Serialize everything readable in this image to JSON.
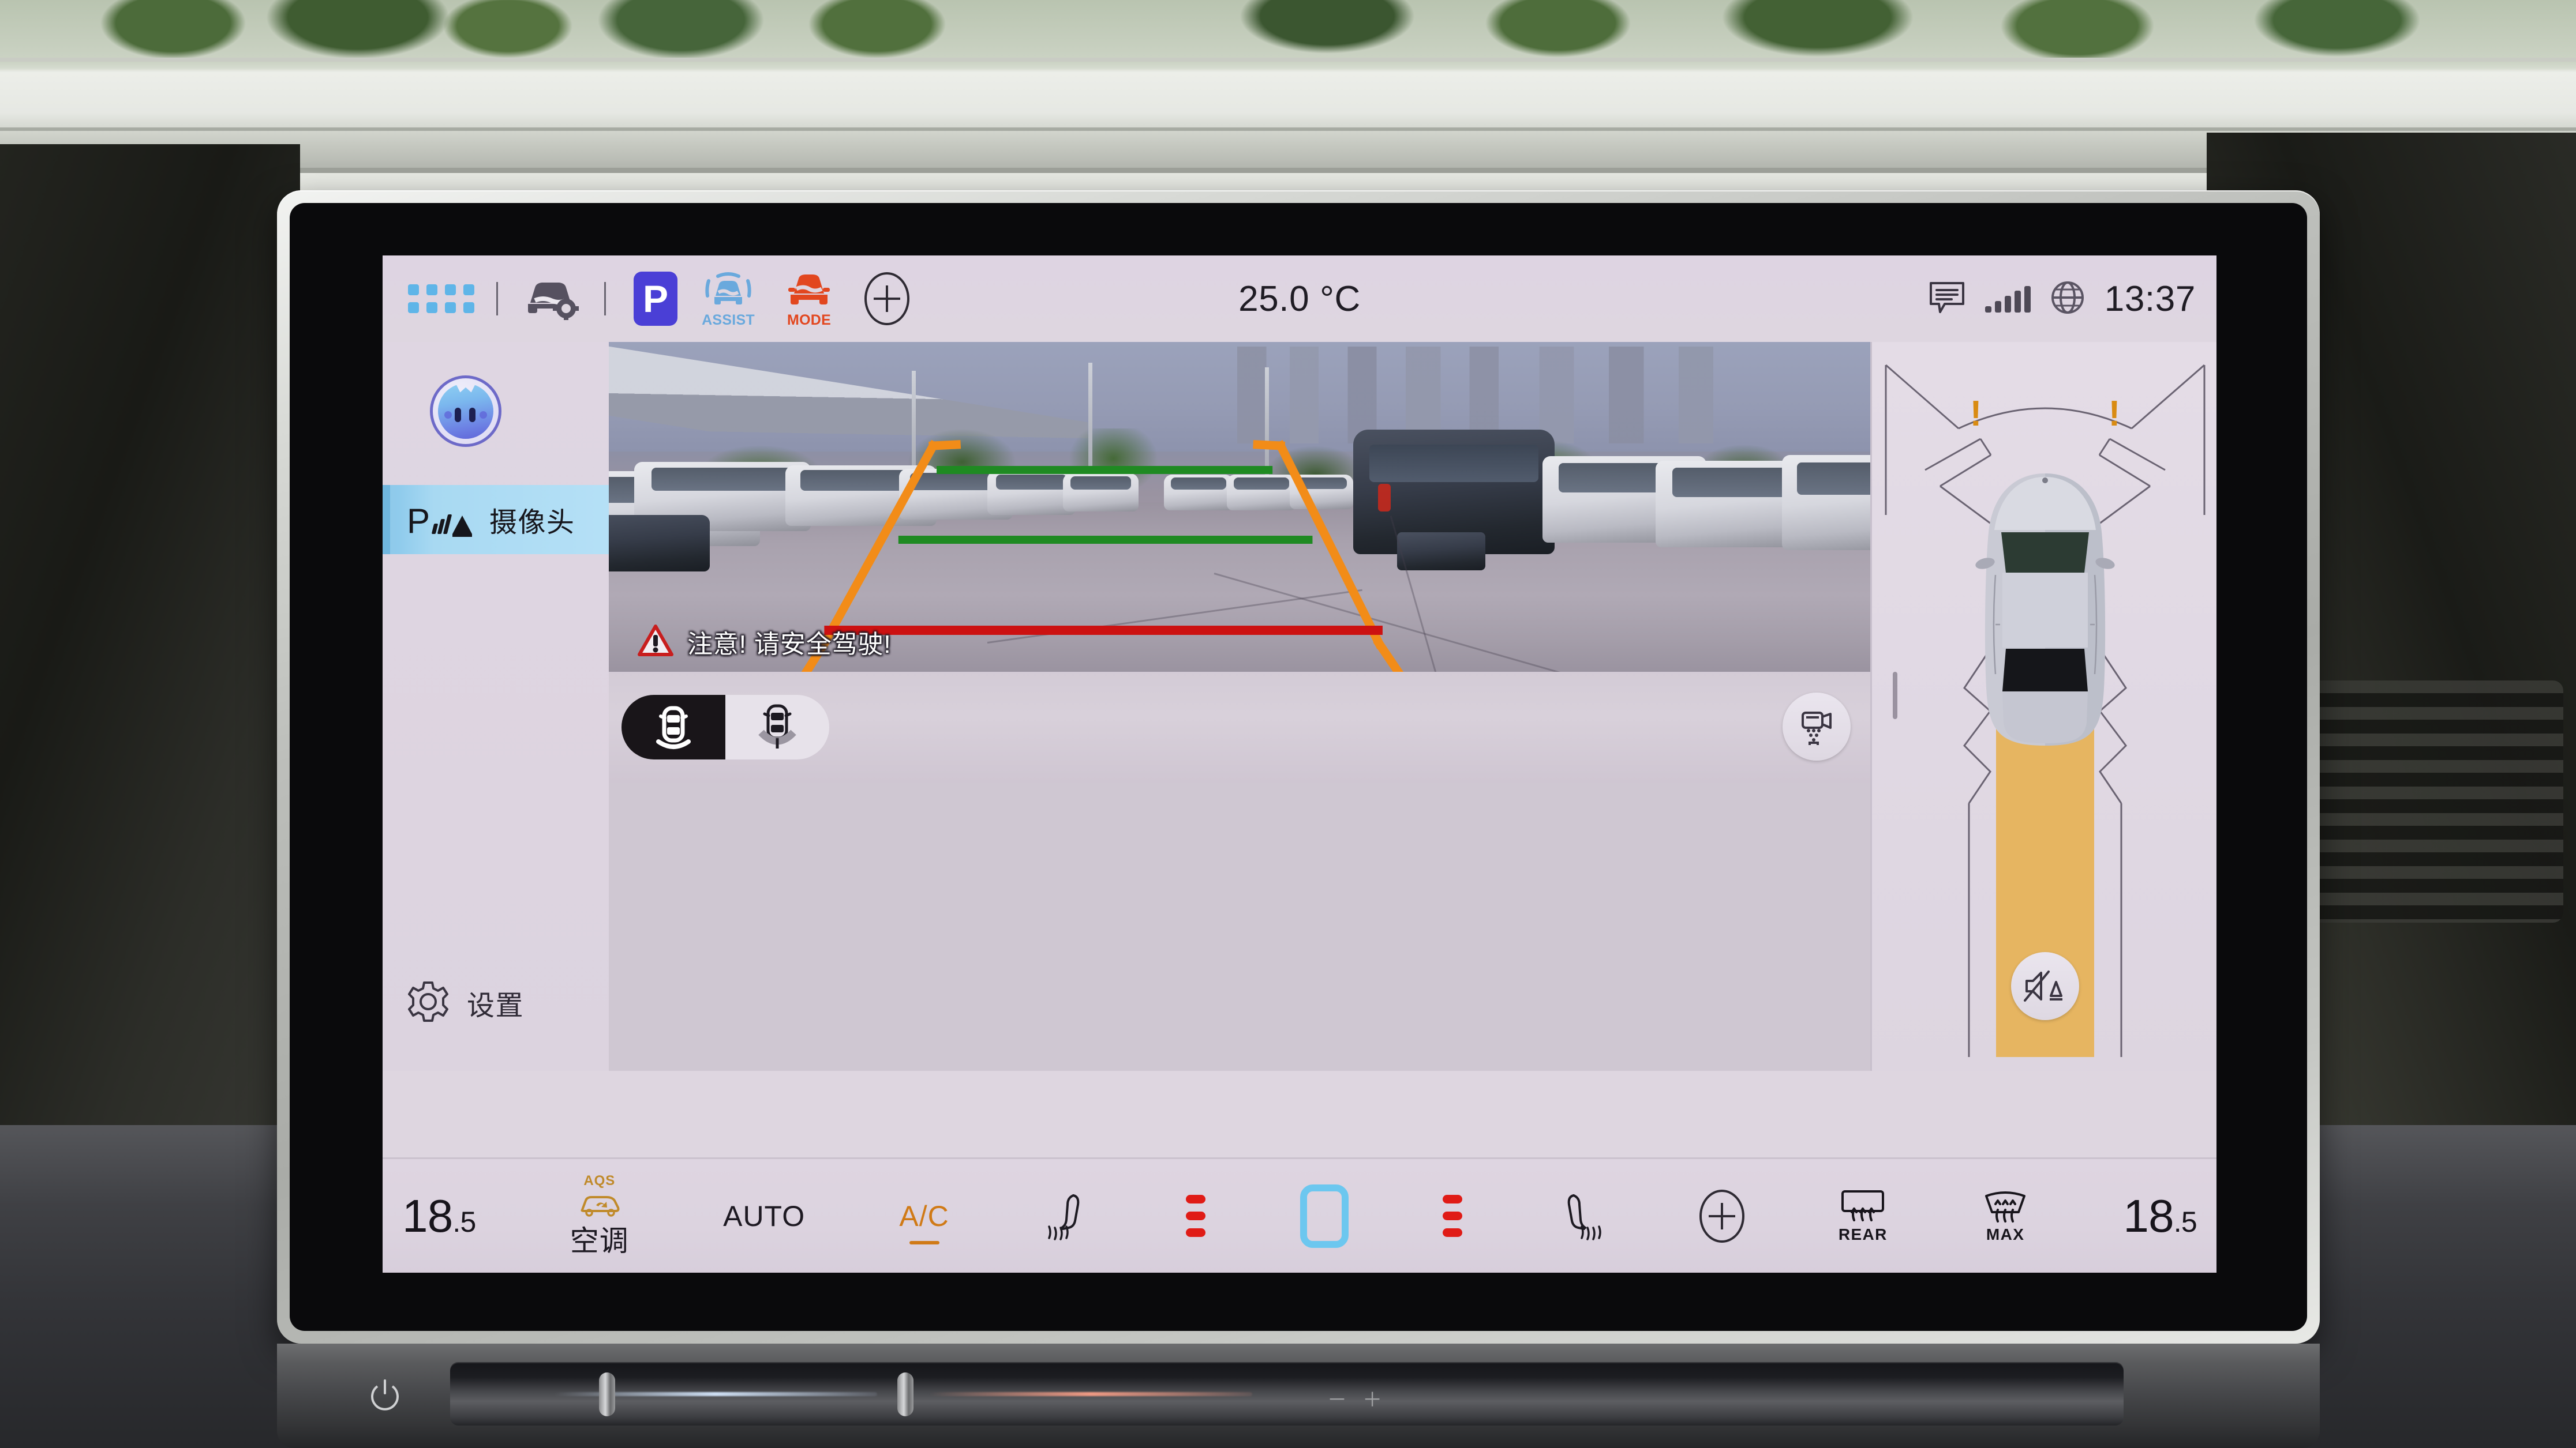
{
  "statusbar": {
    "apps_icon": "grid-apps-icon",
    "car_settings_icon": "car-settings-icon",
    "gear_selector": "P",
    "assist_label": "ASSIST",
    "assist_icon": "park-assist-car-icon",
    "mode_label": "MODE",
    "mode_icon": "drive-mode-car-icon",
    "add_icon": "plus-circle-icon",
    "temperature": "25.0 °C",
    "message_icon": "message-icon",
    "signal_icon": "signal-bars-icon",
    "network_icon": "globe-icon",
    "clock": "13:37"
  },
  "sidebar": {
    "assistant_icon": "voice-assistant-avatar",
    "items": [
      {
        "label": "摄像头",
        "icon": "park-sensor-icon",
        "active": true
      },
      {
        "label": "设置",
        "icon": "gear-icon",
        "active": false
      }
    ]
  },
  "camera": {
    "warning_icon": "warning-triangle-icon",
    "warning_text": "注意! 请安全驾驶!",
    "view_toggle": [
      {
        "name": "rear-view",
        "icon": "car-rear-sensor-icon",
        "active": true
      },
      {
        "name": "front-view",
        "icon": "car-front-sensor-icon",
        "active": false
      }
    ],
    "clean_button_icon": "camera-wash-icon",
    "guide_colors": {
      "outer": "#f28c18",
      "mid": "#1f8a22",
      "near": "#cc1111"
    }
  },
  "park_assist": {
    "mute_icon": "speaker-mute-sensor-icon",
    "vehicle_icon": "top-down-car-icon",
    "front_warnings": [
      "!",
      "!"
    ],
    "front_warning_color": "#d98b12",
    "rear_zone_color": "#e6b35a"
  },
  "climate": {
    "driver_temp": {
      "whole": "18",
      "dec": ".5"
    },
    "passenger_temp": {
      "whole": "18",
      "dec": ".5"
    },
    "aqs_label": "AQS",
    "ac_panel_label": "空调",
    "auto_label": "AUTO",
    "ac_label": "A/C",
    "ac_active": true,
    "seat_left_icon": "heated-seat-left-icon",
    "seat_right_icon": "heated-seat-right-icon",
    "fan_icon": "fan-level-icon",
    "add_icon": "plus-circle-icon",
    "rear_defrost_label": "REAR",
    "max_defrost_label": "MAX",
    "left_levels": 3,
    "right_levels": 3
  },
  "hardware": {
    "power_icon": "power-icon",
    "volume_label": "－                              ＋"
  },
  "colors": {
    "screen_bg": "#ded6e0",
    "accent_blue": "#4a3fd6",
    "accent_orange": "#d07a16",
    "sidebar_active": "#a8d9f2",
    "assist_blue": "#6aa9dd",
    "mode_red": "#e2471f"
  }
}
